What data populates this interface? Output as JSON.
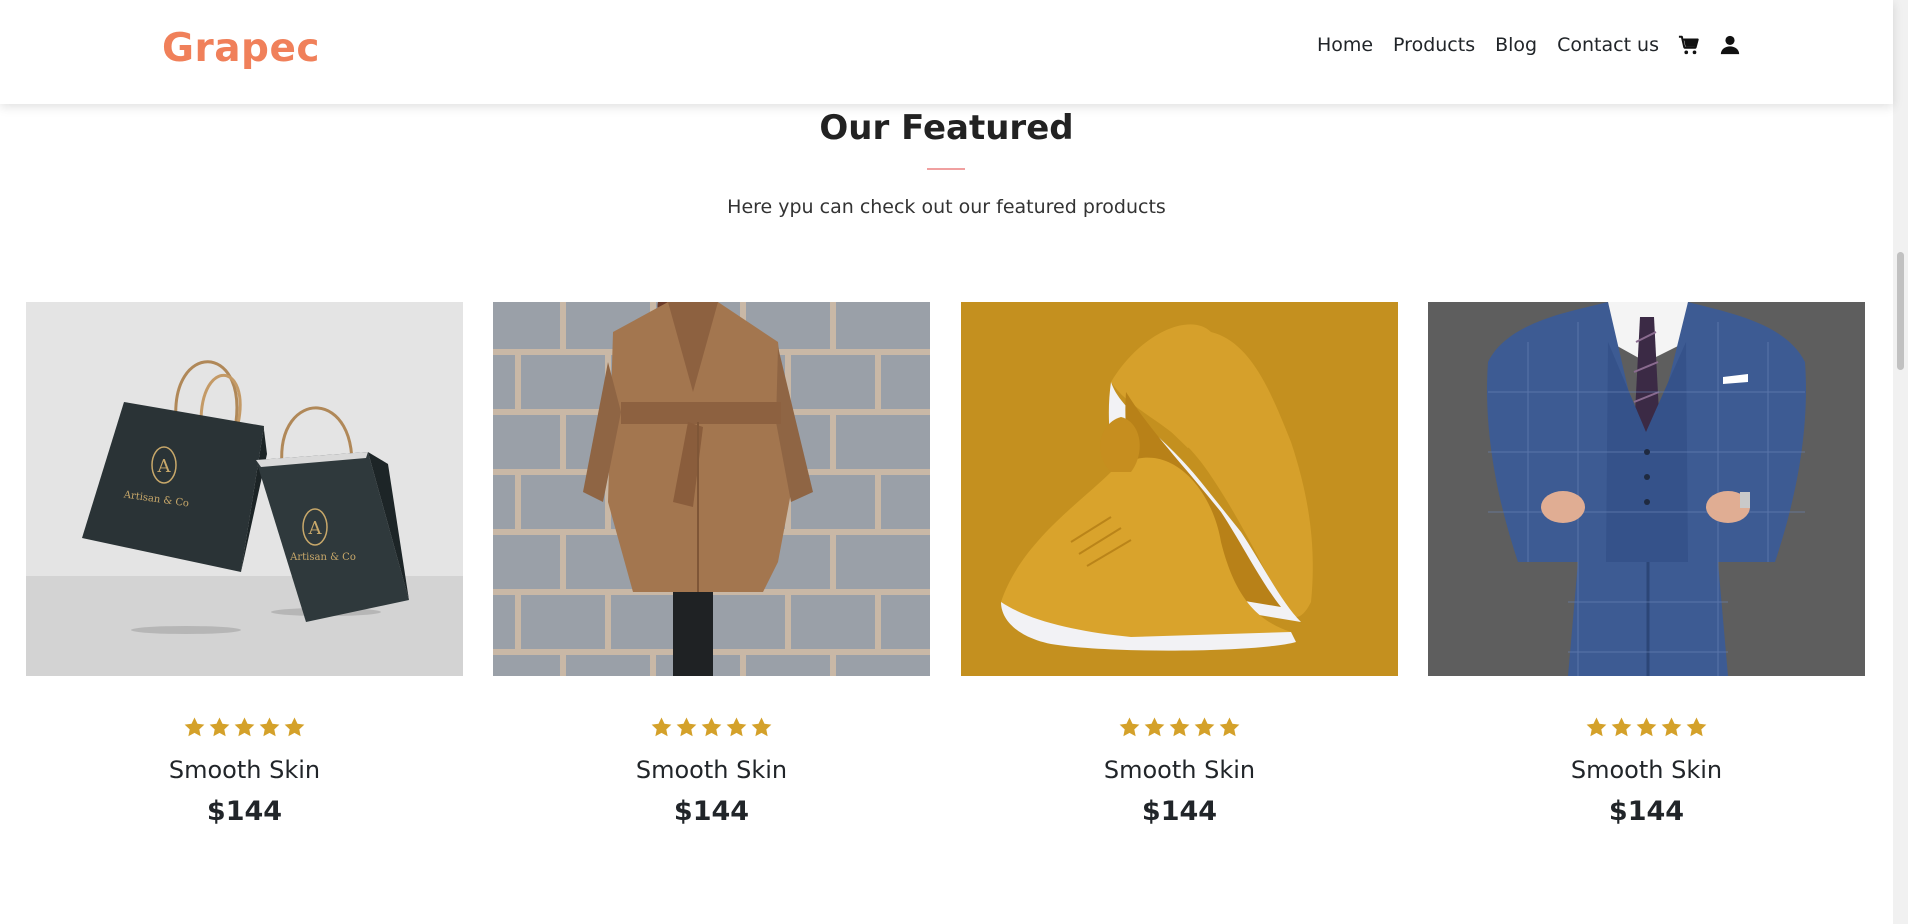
{
  "brand": {
    "name": "Grapec",
    "color": "#f0805a"
  },
  "nav": {
    "links": [
      "Home",
      "Products",
      "Blog",
      "Contact us"
    ],
    "icons": [
      "cart-icon",
      "user-icon"
    ]
  },
  "featured": {
    "title": "Our Featured",
    "subtitle": "Here ypu can check out our featured products"
  },
  "products": [
    {
      "image": "shopping-bags-image",
      "rating": 5,
      "name": "Smooth Skin",
      "price": "$144",
      "bag_text": "Artisan & Co"
    },
    {
      "image": "camel-coat-image",
      "rating": 5,
      "name": "Smooth Skin",
      "price": "$144"
    },
    {
      "image": "yellow-sneakers-image",
      "rating": 5,
      "name": "Smooth Skin",
      "price": "$144"
    },
    {
      "image": "blue-suit-image",
      "rating": 5,
      "name": "Smooth Skin",
      "price": "$144"
    }
  ],
  "colors": {
    "star": "#d4a12a",
    "accent_rule": "#f0a0a0"
  }
}
